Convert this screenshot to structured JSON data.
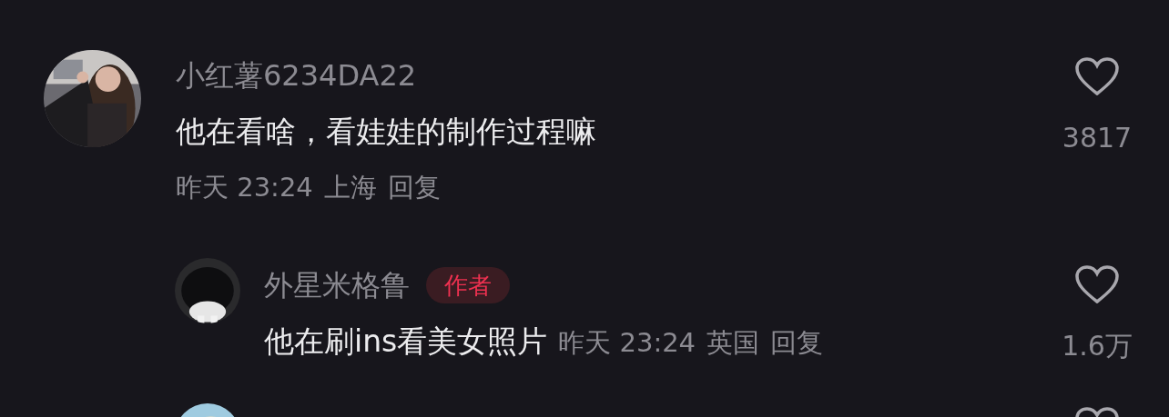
{
  "comments": [
    {
      "username": "小红薯6234DA22",
      "text": "他在看啥，看娃娃的制作过程嘛",
      "time": "昨天 23:24",
      "location": "上海",
      "reply_label": "回复",
      "likes": "3817",
      "liked": false,
      "replies": [
        {
          "username": "外星米格鲁",
          "badge": "作者",
          "text": "他在刷ins看美女照片",
          "time": "昨天 23:24",
          "location": "英国",
          "reply_label": "回复",
          "likes": "1.6万",
          "liked": false
        }
      ]
    }
  ]
}
